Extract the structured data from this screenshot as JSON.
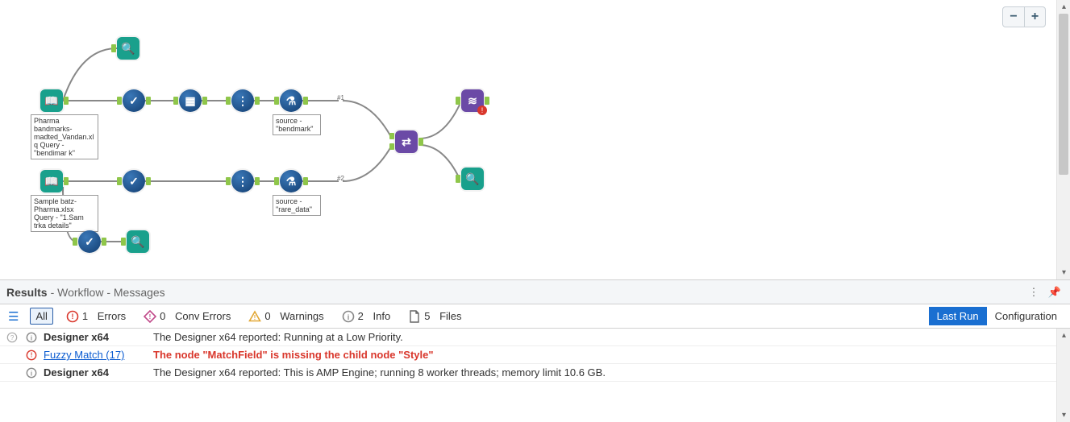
{
  "canvas": {
    "zoom": {
      "out_label": "−",
      "in_label": "+"
    },
    "tools": {
      "input1": {
        "glyph": "📖"
      },
      "input2": {
        "glyph": "📖"
      },
      "browse1": {
        "glyph": "🔍"
      },
      "browse2": {
        "glyph": "🔍"
      },
      "browse3": {
        "glyph": "🔍"
      },
      "select1": {
        "glyph": "✓"
      },
      "select2": {
        "glyph": "✓"
      },
      "select3": {
        "glyph": "✓"
      },
      "recordid1": {
        "glyph": "▦"
      },
      "recordid2": {
        "glyph": "⋮"
      },
      "recordid3": {
        "glyph": "⋮"
      },
      "formula1": {
        "glyph": "⚗"
      },
      "formula2": {
        "glyph": "⚗"
      },
      "union": {
        "glyph": "⇄"
      },
      "fuzzy": {
        "glyph": "≋",
        "error": "!"
      }
    },
    "annotations": {
      "input1": "Pharma bandmarks-madted_Vandan.xl\nq\nQuery - \"bendimar k\"",
      "input2": "Sample batz-Pharma.xlsx\nQuery - \"1.Sam trka details\"",
      "formula1": "source - \"bendmark\"",
      "formula2": "source - \"rare_data\""
    },
    "port_labels": {
      "u1": "#1",
      "u2": "#2"
    }
  },
  "results": {
    "header": {
      "title": "Results",
      "subtitle": "- Workflow - Messages"
    },
    "filters": {
      "all": "All",
      "errors": {
        "count": 1,
        "label": "Errors"
      },
      "conv": {
        "count": 0,
        "label": "Conv Errors"
      },
      "warn": {
        "count": 0,
        "label": "Warnings"
      },
      "info": {
        "count": 2,
        "label": "Info"
      },
      "files": {
        "count": 5,
        "label": "Files"
      }
    },
    "tabs": {
      "lastrun": "Last Run",
      "config": "Configuration"
    },
    "messages": [
      {
        "sev": "info",
        "source": "Designer x64",
        "source_link": false,
        "text": "The Designer x64 reported: Running at a Low Priority."
      },
      {
        "sev": "error",
        "source": "Fuzzy Match (17)",
        "source_link": true,
        "text": "The node \"MatchField\" is missing the child node \"Style\""
      },
      {
        "sev": "info",
        "source": "Designer x64",
        "source_link": false,
        "text": "The Designer x64 reported: This is AMP Engine; running 8 worker threads; memory limit 10.6 GB."
      }
    ]
  },
  "colors": {
    "teal": "#19a08c",
    "blue": "#1a4e8a",
    "purple": "#6b4aa6",
    "error": "#d9372c",
    "info": "#888",
    "warn": "#e2a734",
    "conv": "#c14a8a",
    "tab_active": "#1a6fd1"
  }
}
